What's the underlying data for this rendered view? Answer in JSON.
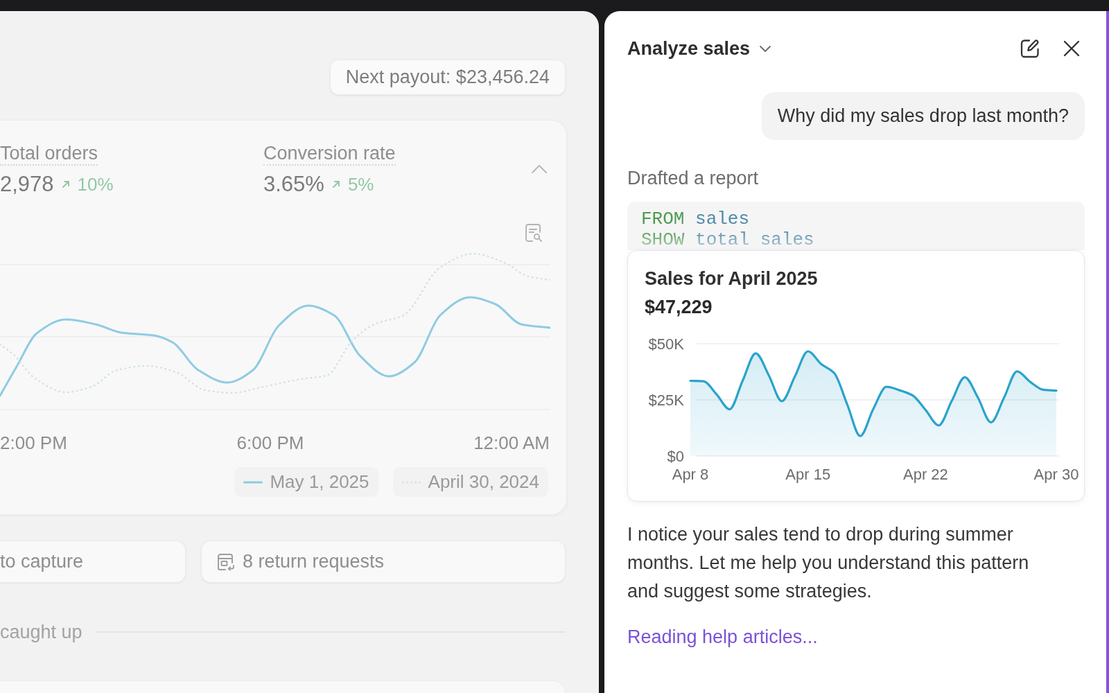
{
  "dashboard": {
    "payout": "Next payout: $23,456.24",
    "metrics_card": {
      "expanded": true,
      "metrics": [
        {
          "label": "Total orders",
          "value": "2,978",
          "change": "10%",
          "rising": true
        },
        {
          "label": "Conversion rate",
          "value": "3.65%",
          "change": "5%",
          "rising": true
        }
      ],
      "x_labels": [
        "2:00 PM",
        "6:00 PM",
        "12:00 AM"
      ],
      "legend": [
        {
          "label": "May 1, 2025",
          "kind": "solid"
        },
        {
          "label": "April 30, 2024",
          "kind": "dotted"
        }
      ]
    },
    "shortcuts": [
      {
        "label": "to capture",
        "kind": "plain"
      },
      {
        "label": "8 return requests",
        "kind": "returns"
      }
    ],
    "divider_label": "caught up"
  },
  "assistant_panel": {
    "title": "Analyze sales",
    "messages": [
      {
        "kind": "user",
        "text": "Why did my sales drop last month?"
      },
      {
        "kind": "status",
        "text": "Drafted a report"
      },
      {
        "kind": "code",
        "lines": [
          [
            {
              "kind": "keyword",
              "text": "FROM"
            },
            {
              "kind": "identifier",
              "text": "sales"
            }
          ],
          [
            {
              "kind": "keyword",
              "text": "SHOW"
            },
            {
              "kind": "identifier",
              "text": "total sales"
            }
          ]
        ]
      },
      {
        "kind": "report",
        "total": "$47,229",
        "chart_data": {
          "type": "area",
          "title": "Sales for April 2025",
          "categories": [
            "Apr 8",
            null,
            null,
            null,
            null,
            null,
            null,
            null,
            null,
            "Apr 15",
            null,
            null,
            null,
            null,
            null,
            null,
            null,
            null,
            "Apr 22",
            null,
            null,
            null,
            null,
            null,
            null,
            null,
            null,
            null,
            "Apr 30"
          ],
          "series": [
            {
              "color": "#2aa3cc",
              "values": [
                33500,
                33300,
                27500,
                20800,
                33500,
                45700,
                36000,
                24400,
                35500,
                46600,
                41000,
                37000,
                23000,
                8900,
                21000,
                30800,
                29300,
                27000,
                20500,
                13600,
                24500,
                35100,
                26000,
                15000,
                26000,
                37700,
                33000,
                29500,
                29100
              ]
            }
          ],
          "ylim": [
            0,
            50000
          ],
          "yticks": [
            {
              "value": 0,
              "label": "$0"
            },
            {
              "value": 25000,
              "label": "$25K"
            },
            {
              "value": 50000,
              "label": "$50K"
            }
          ]
        }
      },
      {
        "kind": "assistant",
        "text": "I notice your sales tend to drop during summer months. Let me help you understand this pattern and suggest some strategies."
      },
      {
        "kind": "progress",
        "text": "Reading help articles..."
      }
    ]
  }
}
